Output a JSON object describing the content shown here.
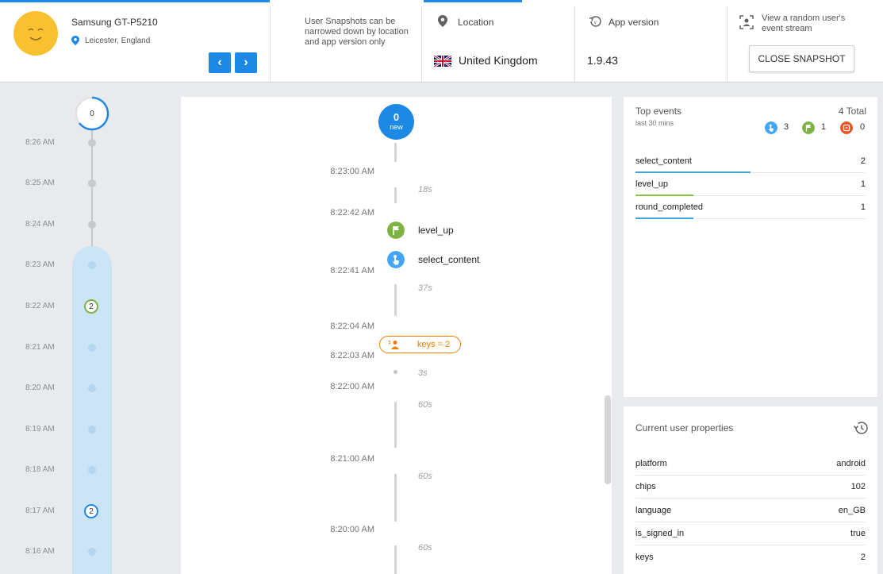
{
  "device": {
    "name": "Samsung GT-P5210",
    "location": "Leicester, England"
  },
  "nav": {
    "prev": "‹",
    "next": "›"
  },
  "hint": "User Snapshots can be narrowed down by location and app version only",
  "location": {
    "label": "Location",
    "value": "United Kingdom"
  },
  "app_version": {
    "label": "App version",
    "value": "1.9.43"
  },
  "random_user": {
    "label": "View a random user's event stream",
    "button": "CLOSE SNAPSHOT"
  },
  "left_timeline": {
    "top_count": "0",
    "times": [
      "8:26 AM",
      "8:25 AM",
      "8:24 AM",
      "8:23 AM",
      "8:22 AM",
      "8:21 AM",
      "8:20 AM",
      "8:19 AM",
      "8:18 AM",
      "8:17 AM",
      "8:16 AM"
    ],
    "counts": {
      "c822": "2",
      "c817": "2"
    }
  },
  "stream": {
    "new_count": "0",
    "new_label": "new",
    "times": [
      "8:23:00 AM",
      "8:22:42 AM",
      "8:22:41 AM",
      "8:22:04 AM",
      "8:22:03 AM",
      "8:22:00 AM",
      "8:21:00 AM",
      "8:20:00 AM"
    ],
    "durations": [
      "18s",
      "37s",
      "3s",
      "60s",
      "60s",
      "60s"
    ],
    "events": [
      "level_up",
      "select_content"
    ],
    "keys_label": "keys = 2"
  },
  "top_events": {
    "title": "Top events",
    "subtitle": "last 30 mins",
    "total": "4 Total",
    "counts": [
      "3",
      "1",
      "0"
    ],
    "rows": [
      {
        "name": "select_content",
        "value": "2",
        "bar": 0.5,
        "color": "#42a5d8"
      },
      {
        "name": "level_up",
        "value": "1",
        "bar": 0.25,
        "color": "#8bc34a"
      },
      {
        "name": "round_completed",
        "value": "1",
        "bar": 0.25,
        "color": "#42a5d8"
      }
    ]
  },
  "user_properties": {
    "title": "Current user properties",
    "rows": [
      {
        "key": "platform",
        "value": "android"
      },
      {
        "key": "chips",
        "value": "102"
      },
      {
        "key": "language",
        "value": "en_GB"
      },
      {
        "key": "is_signed_in",
        "value": "true"
      },
      {
        "key": "keys",
        "value": "2"
      }
    ]
  },
  "colors": {
    "accent": "#1e88e5",
    "green": "#7cb342",
    "orange": "#f57c00",
    "red": "#f4511e",
    "blue": "#42a5f5"
  }
}
